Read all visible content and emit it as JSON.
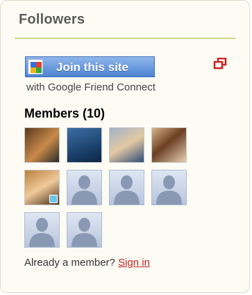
{
  "widget": {
    "title": "Followers",
    "join_button_label": "Join this site",
    "gfc_caption": "with Google Friend Connect",
    "members_heading": "Members (10)",
    "already_member_text": "Already a member?",
    "sign_in_link": "Sign in"
  },
  "icons": {
    "join_logo": "google-friend-connect-icon",
    "popout": "popout-window-icon",
    "generic_avatar": "default-avatar-icon"
  },
  "members": [
    {
      "kind": "photo"
    },
    {
      "kind": "photo"
    },
    {
      "kind": "photo"
    },
    {
      "kind": "photo"
    },
    {
      "kind": "photo"
    },
    {
      "kind": "default"
    },
    {
      "kind": "default"
    },
    {
      "kind": "default"
    },
    {
      "kind": "default"
    },
    {
      "kind": "default"
    }
  ],
  "colors": {
    "title_rule": "#c7d98c",
    "join_button": "#5b8fd8",
    "sign_in_link": "#c41f1f",
    "popout_icon": "#cc2222"
  }
}
